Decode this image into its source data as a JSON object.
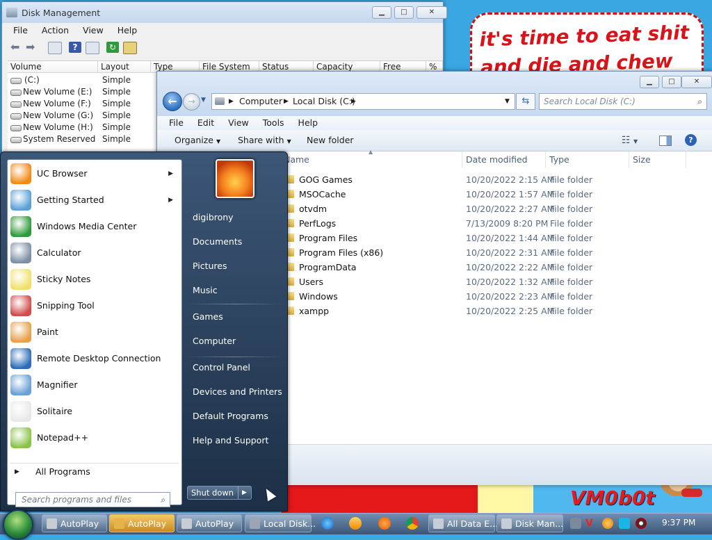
{
  "wallpaper": {
    "meme_text": "it's time to eat shit and die and chew",
    "brand": "VM0b0t"
  },
  "disk_management": {
    "title": "Disk Management",
    "menu": [
      "File",
      "Action",
      "View",
      "Help"
    ],
    "columns": [
      "Volume",
      "Layout",
      "Type",
      "File System",
      "Status",
      "Capacity",
      "Free Spa...",
      "% F"
    ],
    "rows": [
      {
        "volume": "(C:)",
        "layout": "Simple"
      },
      {
        "volume": "New Volume (E:)",
        "layout": "Simple"
      },
      {
        "volume": "New Volume (F:)",
        "layout": "Simple"
      },
      {
        "volume": "New Volume (G:)",
        "layout": "Simple"
      },
      {
        "volume": "New Volume (H:)",
        "layout": "Simple"
      },
      {
        "volume": "System Reserved",
        "layout": "Simple"
      }
    ]
  },
  "explorer": {
    "breadcrumb": [
      "Computer",
      "Local Disk (C:)"
    ],
    "search_placeholder": "Search Local Disk (C:)",
    "menu": [
      "File",
      "Edit",
      "View",
      "Tools",
      "Help"
    ],
    "commands": {
      "organize": "Organize",
      "share": "Share with",
      "new_folder": "New folder"
    },
    "columns": {
      "name": "Name",
      "date": "Date modified",
      "type": "Type",
      "size": "Size"
    },
    "files": [
      {
        "name": "GOG Games",
        "date": "10/20/2022 2:15 AM",
        "type": "File folder"
      },
      {
        "name": "MSOCache",
        "date": "10/20/2022 1:57 AM",
        "type": "File folder"
      },
      {
        "name": "otvdm",
        "date": "10/20/2022 2:27 AM",
        "type": "File folder"
      },
      {
        "name": "PerfLogs",
        "date": "7/13/2009 8:20 PM",
        "type": "File folder"
      },
      {
        "name": "Program Files",
        "date": "10/20/2022 1:44 AM",
        "type": "File folder"
      },
      {
        "name": "Program Files (x86)",
        "date": "10/20/2022 2:31 AM",
        "type": "File folder"
      },
      {
        "name": "ProgramData",
        "date": "10/20/2022 2:22 AM",
        "type": "File folder"
      },
      {
        "name": "Users",
        "date": "10/20/2022 1:32 AM",
        "type": "File folder"
      },
      {
        "name": "Windows",
        "date": "10/20/2022 2:23 AM",
        "type": "File folder"
      },
      {
        "name": "xampp",
        "date": "10/20/2022 2:25 AM",
        "type": "File folder"
      }
    ]
  },
  "start_menu": {
    "programs": [
      {
        "label": "UC Browser",
        "icon": "uc-browser-icon",
        "color": "#f28a14",
        "submenu": true
      },
      {
        "label": "Getting Started",
        "icon": "getting-started-icon",
        "color": "#5aa0d8",
        "submenu": true
      },
      {
        "label": "Windows Media Center",
        "icon": "media-center-icon",
        "color": "#2f9a3a",
        "submenu": false
      },
      {
        "label": "Calculator",
        "icon": "calculator-icon",
        "color": "#7c8fa5",
        "submenu": false
      },
      {
        "label": "Sticky Notes",
        "icon": "sticky-notes-icon",
        "color": "#f2e06a",
        "submenu": false
      },
      {
        "label": "Snipping Tool",
        "icon": "snipping-tool-icon",
        "color": "#d24a4a",
        "submenu": false
      },
      {
        "label": "Paint",
        "icon": "paint-icon",
        "color": "#e6a04a",
        "submenu": false
      },
      {
        "label": "Remote Desktop Connection",
        "icon": "remote-desktop-icon",
        "color": "#2c6cb8",
        "submenu": false
      },
      {
        "label": "Magnifier",
        "icon": "magnifier-icon",
        "color": "#6aa0d6",
        "submenu": false
      },
      {
        "label": "Solitaire",
        "icon": "solitaire-icon",
        "color": "#e8e8e8",
        "submenu": false
      },
      {
        "label": "Notepad++",
        "icon": "notepad-plus-plus-icon",
        "color": "#8bc34a",
        "submenu": false
      }
    ],
    "all_programs": "All Programs",
    "search_placeholder": "Search programs and files",
    "right_items": [
      "digibrony",
      "Documents",
      "Pictures",
      "Music",
      "Games",
      "Computer",
      "Control Panel",
      "Devices and Printers",
      "Default Programs",
      "Help and Support"
    ],
    "shutdown": "Shut down"
  },
  "taskbar": {
    "buttons": [
      {
        "label": "AutoPlay",
        "active": false
      },
      {
        "label": "AutoPlay",
        "active": true
      },
      {
        "label": "AutoPlay",
        "active": false
      },
      {
        "label": "Local Disk...",
        "active": false
      },
      {
        "label": "All Data E...",
        "active": false
      },
      {
        "label": "Disk Man...",
        "active": false
      }
    ],
    "pinned": [
      "internet-explorer-icon",
      "media-player-icon",
      "uc-browser-icon",
      "chrome-icon"
    ],
    "clock": "9:37 PM"
  }
}
